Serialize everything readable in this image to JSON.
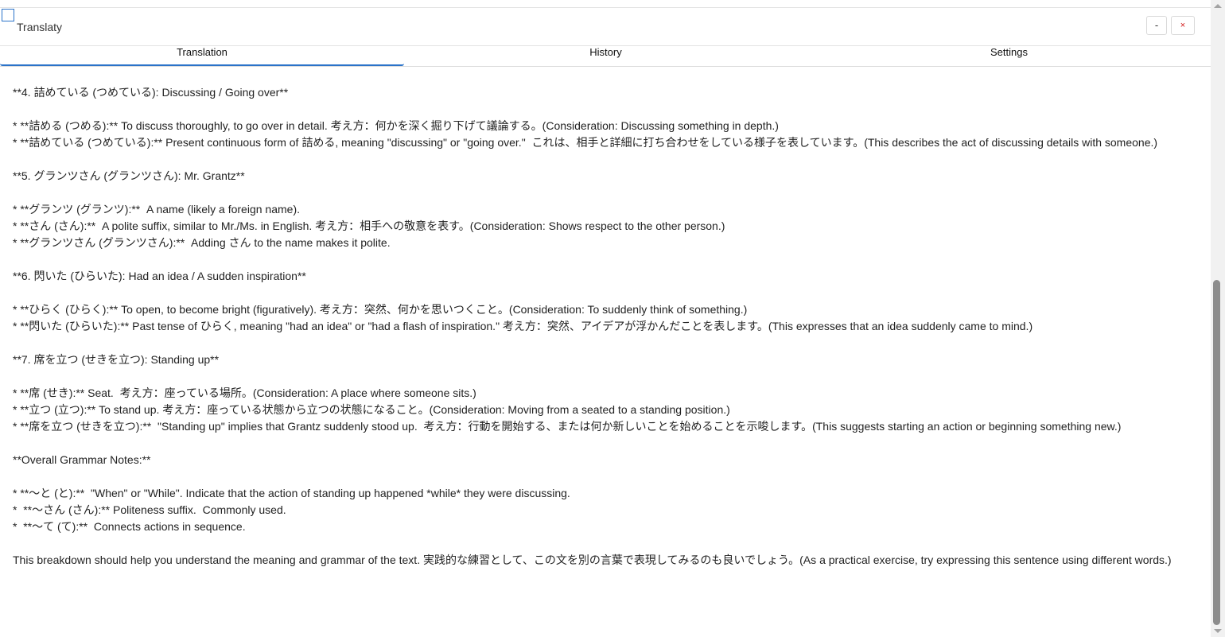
{
  "app": {
    "title": "Translaty",
    "minimize_label": "-",
    "close_label": "×"
  },
  "tabs": [
    {
      "label": "Translation",
      "active": true
    },
    {
      "label": "History",
      "active": false
    },
    {
      "label": "Settings",
      "active": false
    }
  ],
  "content": {
    "lines": [
      "**4. 詰めている (つめている): Discussing / Going over**",
      "",
      "* **詰める (つめる):** To discuss thoroughly, to go over in detail. 考え方：何かを深く掘り下げて議論する。(Consideration: Discussing something in depth.)",
      "* **詰めている (つめている):** Present continuous form of 詰める, meaning \"discussing\" or \"going over.\"  これは、相手と詳細に打ち合わせをしている様子を表しています。(This describes the act of discussing details with someone.)",
      "",
      "**5. グランツさん (グランツさん): Mr. Grantz**",
      "",
      "* **グランツ (グランツ):**  A name (likely a foreign name).",
      "* **さん (さん):**  A polite suffix, similar to Mr./Ms. in English. 考え方：相手への敬意を表す。(Consideration: Shows respect to the other person.)",
      "* **グランツさん (グランツさん):**  Adding さん to the name makes it polite.",
      "",
      "**6. 閃いた (ひらいた): Had an idea / A sudden inspiration**",
      "",
      "* **ひらく (ひらく):** To open, to become bright (figuratively). 考え方：突然、何かを思いつくこと。(Consideration: To suddenly think of something.)",
      "* **閃いた (ひらいた):** Past tense of ひらく, meaning \"had an idea\" or \"had a flash of inspiration.\" 考え方：突然、アイデアが浮かんだことを表します。(This expresses that an idea suddenly came to mind.)",
      "",
      "**7. 席を立つ (せきを立つ): Standing up**",
      "",
      "* **席 (せき):** Seat.  考え方：座っている場所。(Consideration: A place where someone sits.)",
      "* **立つ (立つ):** To stand up. 考え方：座っている状態から立つの状態になること。(Consideration: Moving from a seated to a standing position.)",
      "* **席を立つ (せきを立つ):**  \"Standing up\" implies that Grantz suddenly stood up.  考え方：行動を開始する、または何か新しいことを始めることを示唆します。(This suggests starting an action or beginning something new.)",
      "",
      "**Overall Grammar Notes:**",
      "",
      "* **～と (と):**  \"When\" or \"While\". Indicate that the action of standing up happened *while* they were discussing.",
      "*  **～さん (さん):** Politeness suffix.  Commonly used.",
      "*  **～て (て):**  Connects actions in sequence.",
      "",
      "This breakdown should help you understand the meaning and grammar of the text. 実践的な練習として、この文を別の言葉で表現してみるのも良いでしょう。(As a practical exercise, try expressing this sentence using different words.)"
    ]
  },
  "colors": {
    "accent": "#2b73c9",
    "close": "#d11a1a",
    "text": "#222222",
    "border": "#e3e3e3"
  },
  "scroll": {
    "position_fraction": 0.55
  }
}
